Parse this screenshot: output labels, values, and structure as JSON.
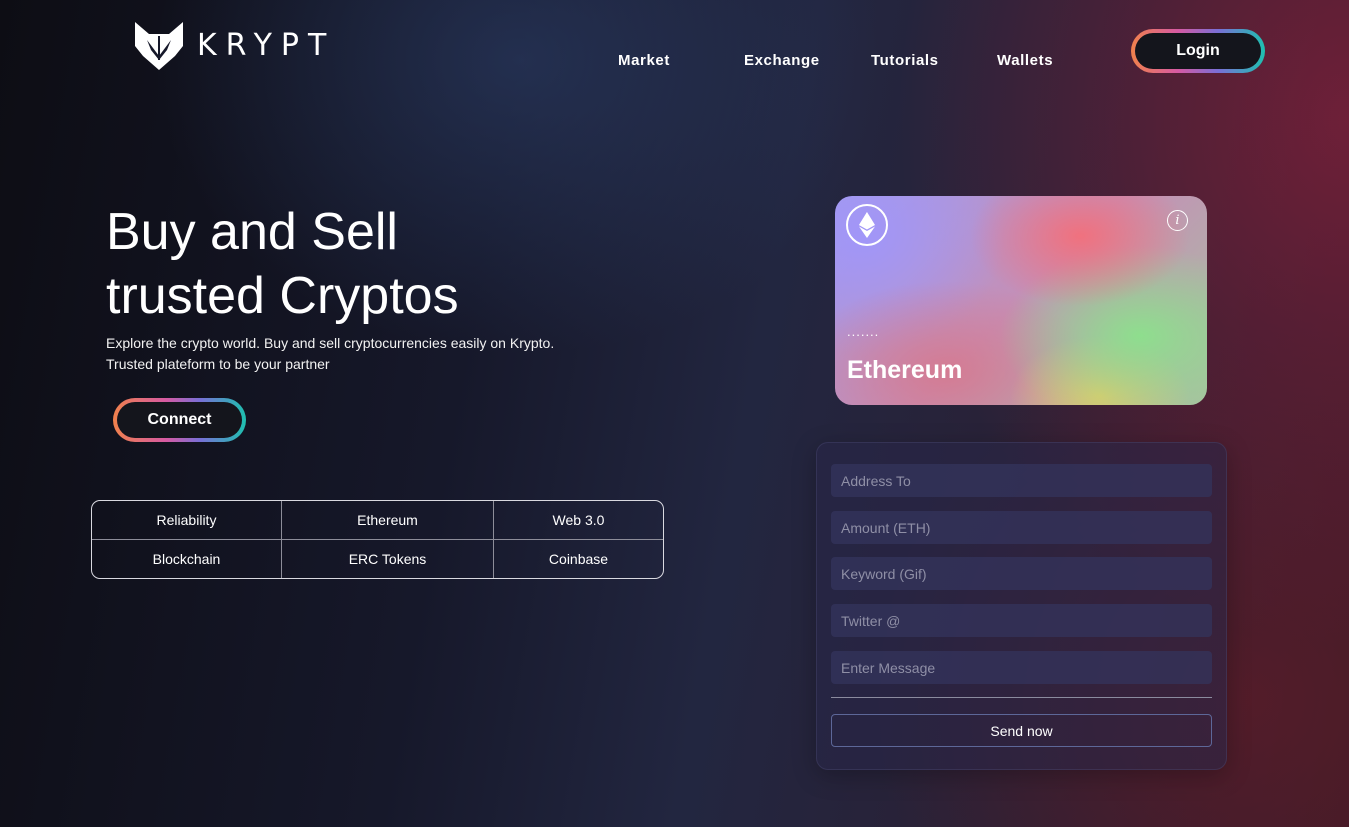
{
  "brand": {
    "name": "KRYPT",
    "logo_icon": "fox-logo-icon"
  },
  "nav": {
    "items": [
      {
        "label": "Market"
      },
      {
        "label": "Exchange"
      },
      {
        "label": "Tutorials"
      },
      {
        "label": "Wallets"
      }
    ],
    "login_label": "Login"
  },
  "hero": {
    "title_line1": "Buy and Sell",
    "title_line2": "trusted Cryptos",
    "desc_line1": "Explore the crypto world. Buy and sell cryptocurrencies easily on Krypto.",
    "desc_line2": "Trusted plateform to be your partner",
    "connect_label": "Connect"
  },
  "features": [
    "Reliability",
    "Ethereum",
    "Web 3.0",
    "Blockchain",
    "ERC Tokens",
    "Coinbase"
  ],
  "card": {
    "address": ".......",
    "network": "Ethereum",
    "icons": [
      "ethereum-icon",
      "info-icon"
    ],
    "info_glyph": "i"
  },
  "form": {
    "address_placeholder": "Address To",
    "amount_placeholder": "Amount (ETH)",
    "keyword_placeholder": "Keyword (Gif)",
    "twitter_placeholder": "Twitter @",
    "message_placeholder": "Enter Message",
    "send_label": "Send now"
  },
  "colors": {
    "gradient_border": [
      "#f0814c",
      "#d65aa3",
      "#7a6fd6",
      "#1ec0b0"
    ],
    "button_fill": "#14151c",
    "panel_bg": "#282648"
  }
}
